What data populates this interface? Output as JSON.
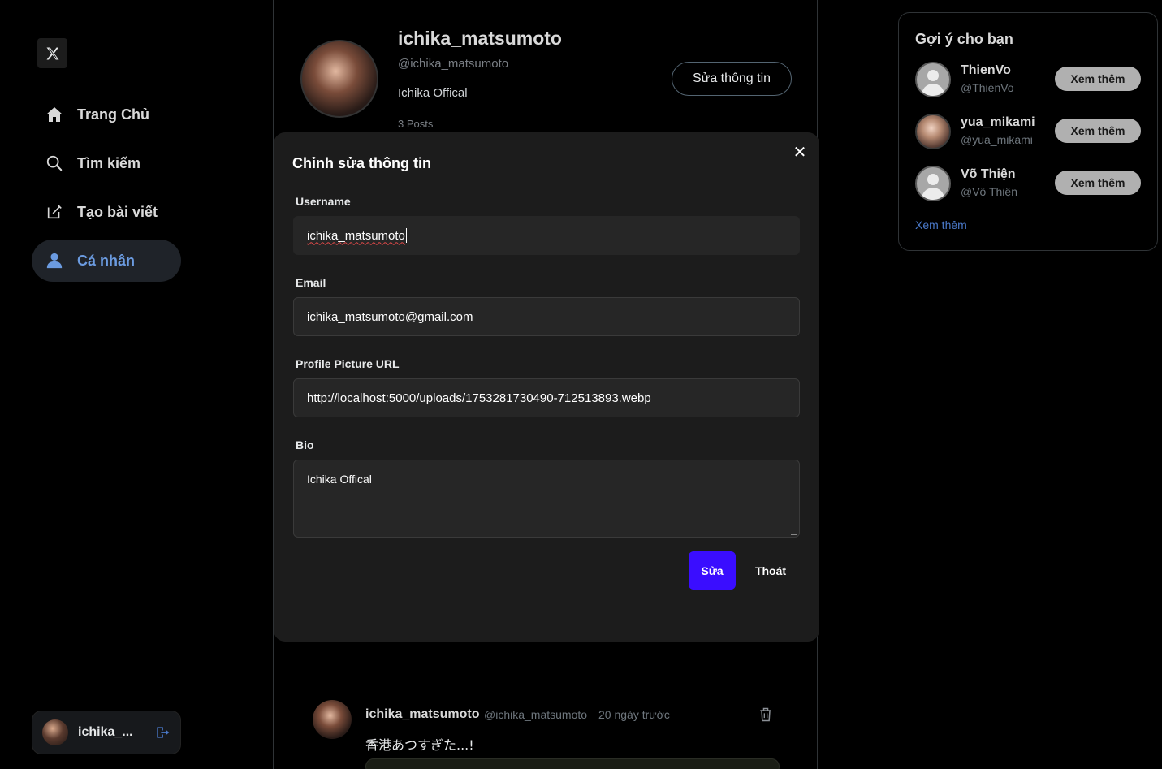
{
  "app": {
    "accent": "#3a0dff",
    "link_color": "#4a79c9"
  },
  "sidebar": {
    "logo_icon": "x-logo-icon",
    "items": [
      {
        "label": "Trang Chủ",
        "icon": "home-icon"
      },
      {
        "label": "Tìm kiếm",
        "icon": "search-icon"
      },
      {
        "label": "Tạo bài viết",
        "icon": "compose-icon"
      },
      {
        "label": "Cá nhân",
        "icon": "user-icon",
        "active": true
      }
    ],
    "current_user": {
      "name": "ichika_...",
      "logout_icon": "logout-icon"
    }
  },
  "profile": {
    "name": "ichika_matsumoto",
    "handle": "@ichika_matsumoto",
    "bio": "Ichika Offical",
    "posts_count": "3 Posts",
    "edit_button": "Sửa thông tin"
  },
  "post": {
    "name": "ichika_matsumoto",
    "handle": "@ichika_matsumoto",
    "time": "20 ngày trước",
    "text": "香港あつすぎた...!"
  },
  "suggestions": {
    "title": "Gợi ý cho bạn",
    "users": [
      {
        "name": "ThienVo",
        "handle": "@ThienVo",
        "button": "Xem thêm"
      },
      {
        "name": "yua_mikami",
        "handle": "@yua_mikami",
        "button": "Xem thêm"
      },
      {
        "name": "Võ Thiện",
        "handle": "@Võ Thiện",
        "button": "Xem thêm"
      }
    ],
    "see_more": "Xem thêm"
  },
  "modal": {
    "title": "Chỉnh sửa thông tin",
    "username_label": "Username",
    "username_value": "ichika_matsumoto",
    "email_label": "Email",
    "email_value": "ichika_matsumoto@gmail.com",
    "avatar_label": "Profile Picture URL",
    "avatar_value": "http://localhost:5000/uploads/1753281730490-712513893.webp",
    "bio_label": "Bio",
    "bio_value": "Ichika Offical",
    "submit_label": "Sửa",
    "cancel_label": "Thoát"
  }
}
